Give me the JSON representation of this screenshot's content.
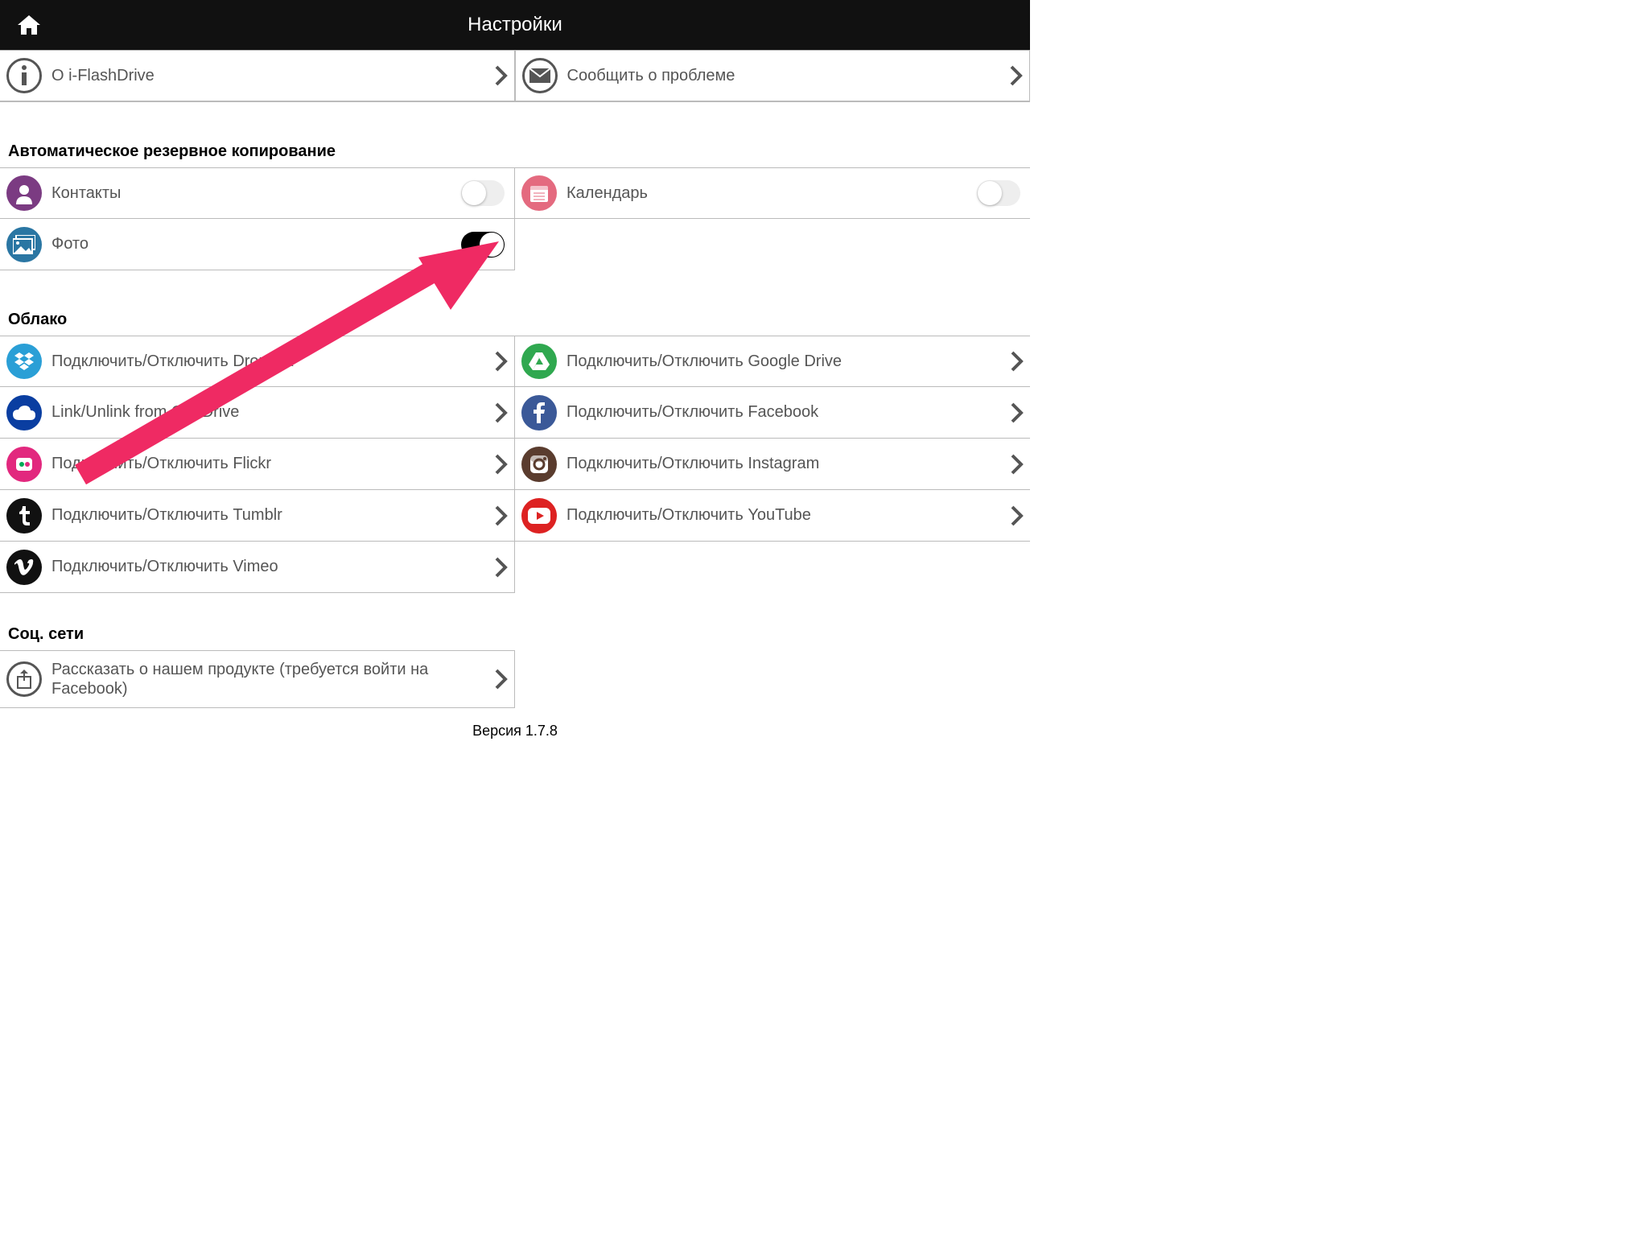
{
  "header": {
    "title": "Настройки"
  },
  "top": {
    "about": "О i-FlashDrive",
    "report": "Сообщить о проблеме"
  },
  "sections": {
    "backup": "Автоматическое резервное копирование",
    "cloud": "Облако",
    "social": "Соц. сети"
  },
  "backup": {
    "contacts": "Контакты",
    "calendar": "Календарь",
    "photo": "Фото",
    "contacts_on": false,
    "calendar_on": false,
    "photo_on": true
  },
  "cloud": {
    "dropbox": "Подключить/Отключить Dropbox",
    "onedrive": "Link/Unlink from OneDrive",
    "flickr": "Подключить/Отключить  Flickr",
    "tumblr": "Подключить/Отключить Tumblr",
    "vimeo": "Подключить/Отключить Vimeo",
    "gdrive": "Подключить/Отключить Google Drive",
    "facebook": "Подключить/Отключить Facebook",
    "instagram": "Подключить/Отключить Instagram",
    "youtube": "Подключить/Отключить YouTube"
  },
  "social": {
    "share": "Рассказать о нашем продукте (требуется войти на Facebook)"
  },
  "version": "Версия 1.7.8",
  "colors": {
    "contacts": "#7b3b82",
    "calendar": "#e46a7f",
    "photo": "#2a76a3",
    "dropbox": "#2a9fd6",
    "onedrive": "#0a3ea1",
    "flickr": "#e2287e",
    "tumblr": "#111",
    "vimeo": "#111",
    "gdrive": "#2fa84f",
    "facebook": "#3b5998",
    "instagram": "#5a3c2e",
    "youtube": "#d22",
    "info": "#555",
    "mail": "#555",
    "share": "#555"
  }
}
